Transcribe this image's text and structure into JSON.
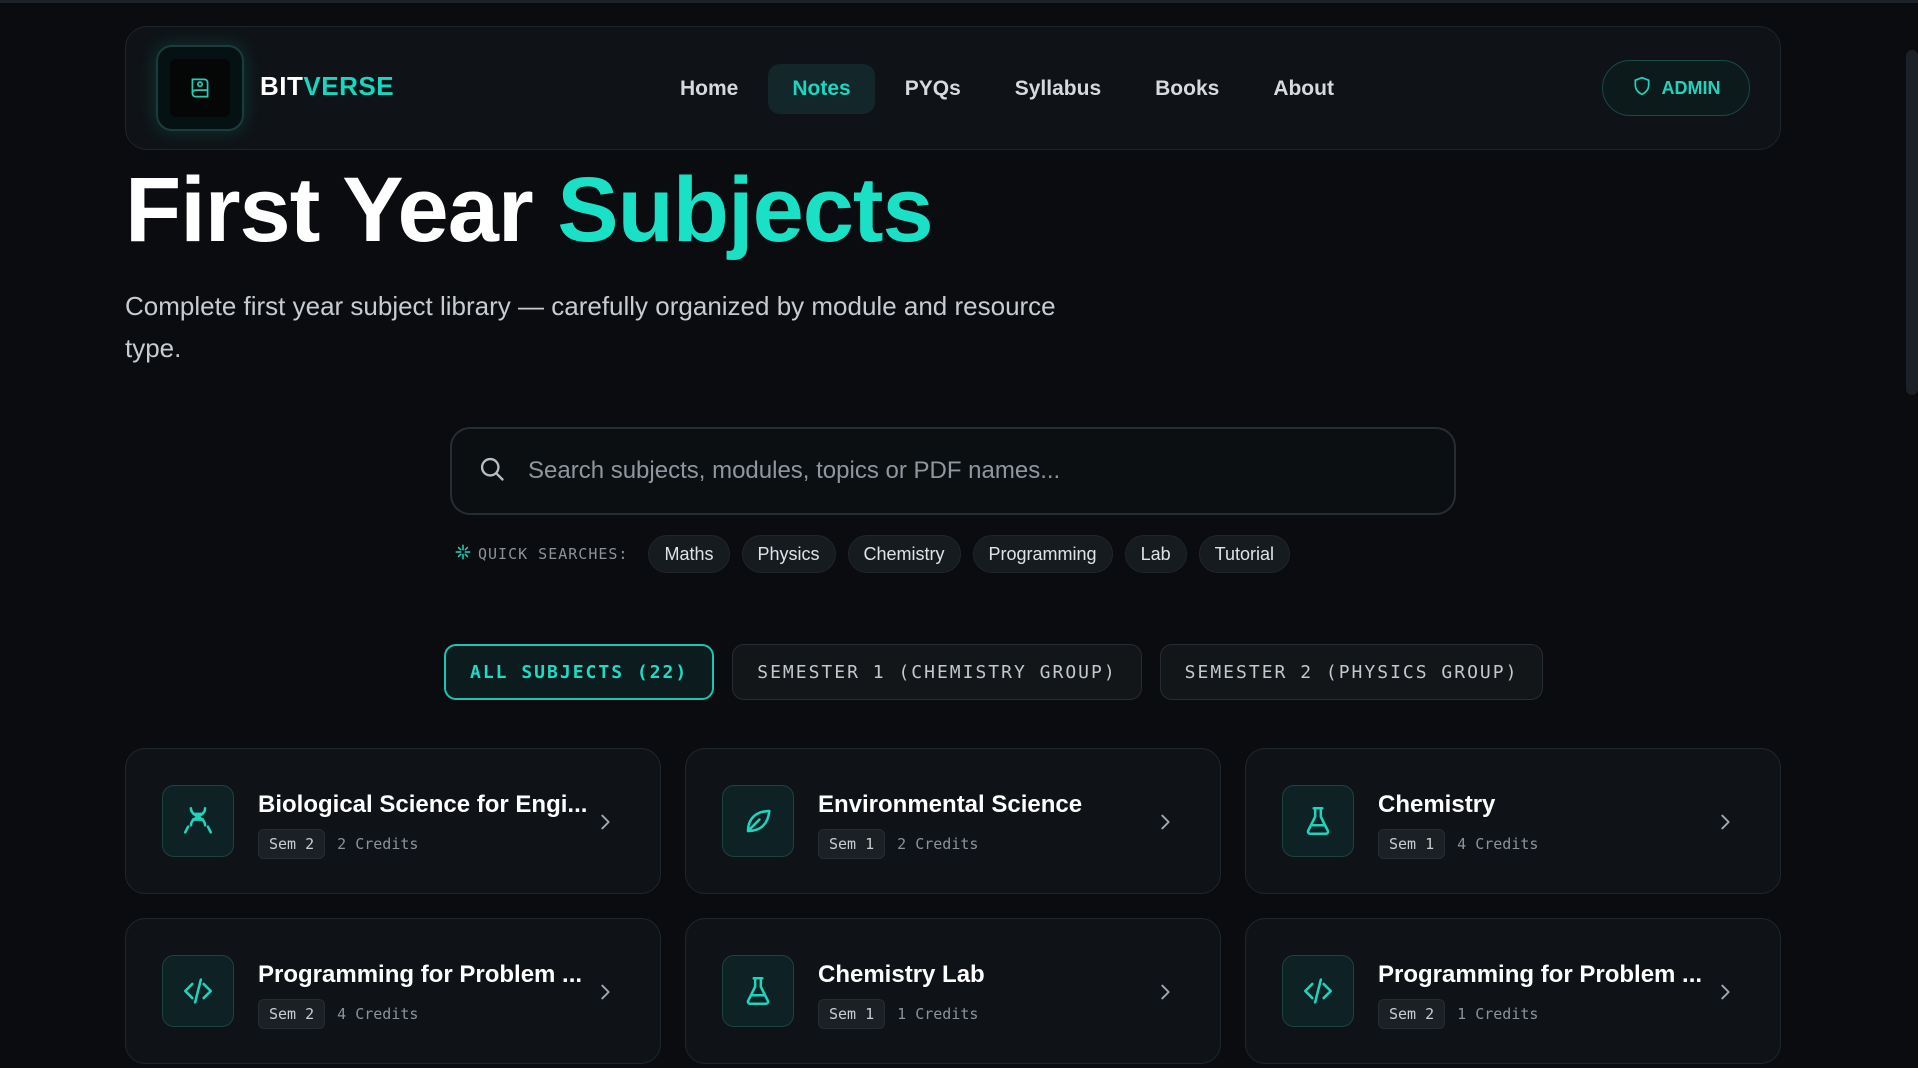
{
  "nav": {
    "brand_part1": "BIT",
    "brand_part2": "VERSE",
    "items": [
      {
        "label": "Home"
      },
      {
        "label": "Notes"
      },
      {
        "label": "PYQs"
      },
      {
        "label": "Syllabus"
      },
      {
        "label": "Books"
      },
      {
        "label": "About"
      }
    ],
    "active_item": "Notes",
    "admin_label": "ADMIN"
  },
  "hero": {
    "title_part1": "First Year",
    "title_part2": "Subjects",
    "subtitle": "Complete first year subject library — carefully organized by module and resource type."
  },
  "search": {
    "placeholder": "Search subjects, modules, topics or PDF names...",
    "value": ""
  },
  "quick": {
    "label": "QUICK SEARCHES:",
    "chips": [
      "Maths",
      "Physics",
      "Chemistry",
      "Programming",
      "Lab",
      "Tutorial"
    ]
  },
  "filters": {
    "items": [
      {
        "label": "ALL SUBJECTS (22)"
      },
      {
        "label": "SEMESTER 1 (CHEMISTRY GROUP)"
      },
      {
        "label": "SEMESTER 2 (PHYSICS GROUP)"
      }
    ],
    "active": "ALL SUBJECTS (22)"
  },
  "cards": [
    {
      "title": "Biological Science for Engi...",
      "sem": "Sem 2",
      "credits": "2 Credits",
      "icon": "dna-icon"
    },
    {
      "title": "Environmental Science",
      "sem": "Sem 1",
      "credits": "2 Credits",
      "icon": "leaf-icon"
    },
    {
      "title": "Chemistry",
      "sem": "Sem 1",
      "credits": "4 Credits",
      "icon": "flask-icon"
    },
    {
      "title": "Programming for Problem ...",
      "sem": "Sem 2",
      "credits": "4 Credits",
      "icon": "code-icon"
    },
    {
      "title": "Chemistry Lab",
      "sem": "Sem 1",
      "credits": "1 Credits",
      "icon": "flask-icon"
    },
    {
      "title": "Programming for Problem ...",
      "sem": "Sem 2",
      "credits": "1 Credits",
      "icon": "code-icon"
    }
  ],
  "colors": {
    "accent": "#1ae0c6",
    "background": "#0a0c0f",
    "card": "#0f1317"
  }
}
